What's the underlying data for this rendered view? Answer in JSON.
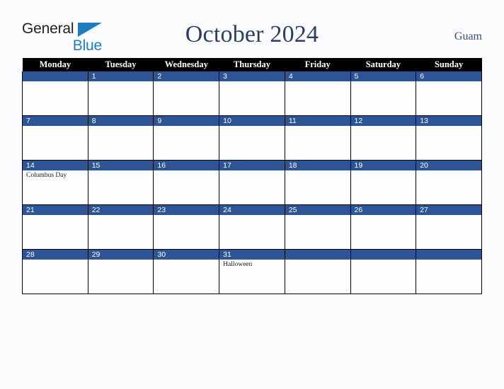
{
  "brand": {
    "name_part1": "General",
    "name_part2": "Blue",
    "triangle_icon": "triangle-icon",
    "accent_color": "#1f7cc1",
    "text_color": "#231f20"
  },
  "header": {
    "title": "October 2024",
    "region": "Guam",
    "title_color": "#2b3f63"
  },
  "calendar": {
    "weekday_headers": [
      "Monday",
      "Tuesday",
      "Wednesday",
      "Thursday",
      "Friday",
      "Saturday",
      "Sunday"
    ],
    "header_bg": "#000000",
    "daynum_bg": "#2d5494",
    "cell_bg": "#fdfdfd",
    "weeks": [
      [
        {
          "day": "",
          "events": []
        },
        {
          "day": "1",
          "events": []
        },
        {
          "day": "2",
          "events": []
        },
        {
          "day": "3",
          "events": []
        },
        {
          "day": "4",
          "events": []
        },
        {
          "day": "5",
          "events": []
        },
        {
          "day": "6",
          "events": []
        }
      ],
      [
        {
          "day": "7",
          "events": []
        },
        {
          "day": "8",
          "events": []
        },
        {
          "day": "9",
          "events": []
        },
        {
          "day": "10",
          "events": []
        },
        {
          "day": "11",
          "events": []
        },
        {
          "day": "12",
          "events": []
        },
        {
          "day": "13",
          "events": []
        }
      ],
      [
        {
          "day": "14",
          "events": [
            "Columbus Day"
          ]
        },
        {
          "day": "15",
          "events": []
        },
        {
          "day": "16",
          "events": []
        },
        {
          "day": "17",
          "events": []
        },
        {
          "day": "18",
          "events": []
        },
        {
          "day": "19",
          "events": []
        },
        {
          "day": "20",
          "events": []
        }
      ],
      [
        {
          "day": "21",
          "events": []
        },
        {
          "day": "22",
          "events": []
        },
        {
          "day": "23",
          "events": []
        },
        {
          "day": "24",
          "events": []
        },
        {
          "day": "25",
          "events": []
        },
        {
          "day": "26",
          "events": []
        },
        {
          "day": "27",
          "events": []
        }
      ],
      [
        {
          "day": "28",
          "events": []
        },
        {
          "day": "29",
          "events": []
        },
        {
          "day": "30",
          "events": []
        },
        {
          "day": "31",
          "events": [
            "Halloween"
          ]
        },
        {
          "day": "",
          "events": []
        },
        {
          "day": "",
          "events": []
        },
        {
          "day": "",
          "events": []
        }
      ]
    ]
  }
}
